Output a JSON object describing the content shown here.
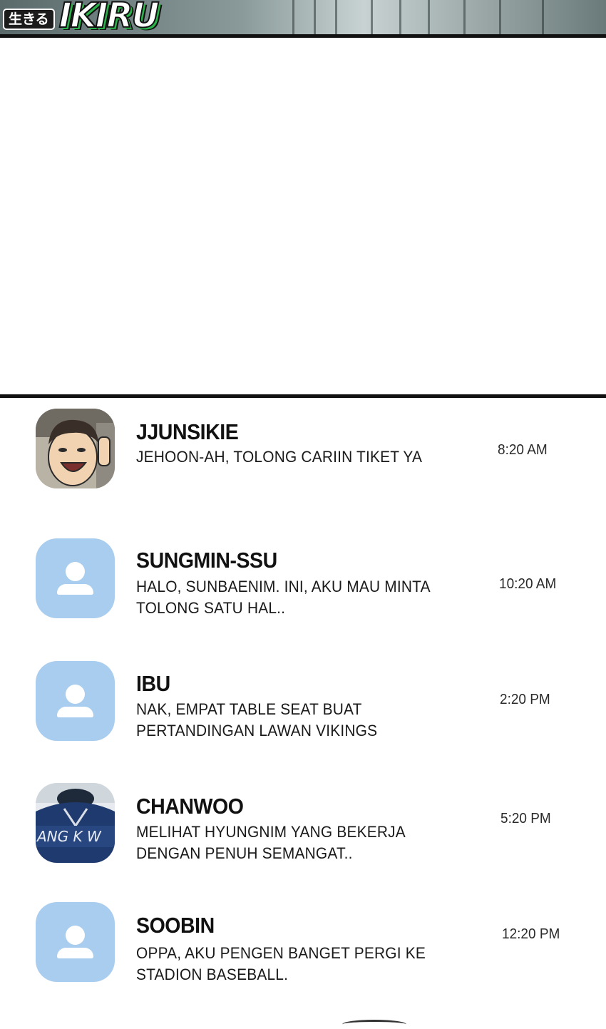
{
  "header": {
    "logo_badge": "生きる",
    "logo_word": "IKIRU",
    "accent_color": "#2ab34a"
  },
  "messages": [
    {
      "name": "JJUNSIKIE",
      "text_lines": [
        "JEHOON-AH, TOLONG CARIIN TIKET YA"
      ],
      "time": "8:20 AM",
      "avatar": "photo-boy"
    },
    {
      "name": "SUNGMIN-SSU",
      "text_lines": [
        "HALO, SUNBAENIM. INI, AKU MAU MINTA",
        "TOLONG SATU HAL.."
      ],
      "time": "10:20 AM",
      "avatar": "default-user-icon"
    },
    {
      "name": "IBU",
      "text_lines": [
        "NAK, EMPAT TABLE SEAT BUAT",
        "PERTANDINGAN LAWAN VIKINGS"
      ],
      "time": "2:20 PM",
      "avatar": "default-user-icon"
    },
    {
      "name": "CHANWOO",
      "text_lines": [
        "MELIHAT HYUNGNIM YANG BEKERJA",
        "DENGAN PENUH SEMANGAT.."
      ],
      "time": "5:20 PM",
      "avatar": "photo-jersey",
      "avatar_text": "ANG K W"
    },
    {
      "name": "SOOBIN",
      "text_lines": [
        "OPPA, AKU PENGEN BANGET PERGI KE",
        "STADION BASEBALL."
      ],
      "time": "12:20 PM",
      "avatar": "default-user-icon"
    }
  ],
  "colors": {
    "default_avatar_bg": "#a9cdee"
  }
}
